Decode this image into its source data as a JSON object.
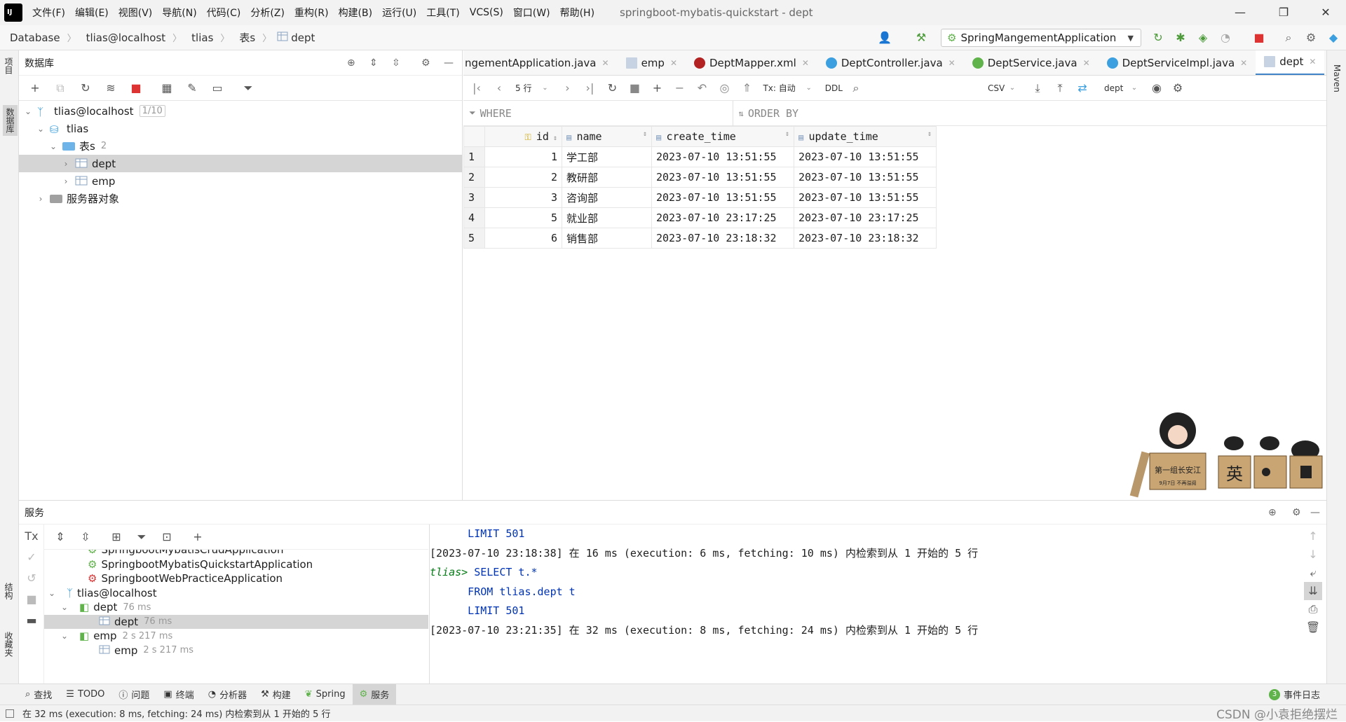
{
  "menu": [
    "文件(F)",
    "编辑(E)",
    "视图(V)",
    "导航(N)",
    "代码(C)",
    "分析(Z)",
    "重构(R)",
    "构建(B)",
    "运行(U)",
    "工具(T)",
    "VCS(S)",
    "窗口(W)",
    "帮助(H)"
  ],
  "window_title": "springboot-mybatis-quickstart - dept",
  "breadcrumb": [
    "Database",
    "tlias@localhost",
    "tlias",
    "表s",
    "dept"
  ],
  "run_config": "SpringMangementApplication",
  "left_strip": {
    "project": "项目",
    "database": "数据库",
    "structure": "结构",
    "bookmarks": "收藏夹"
  },
  "right_strip": {
    "maven": "Maven"
  },
  "db_panel": {
    "title": "数据库",
    "tree": {
      "host": "tlias@localhost",
      "host_count": "1/10",
      "schema": "tlias",
      "tables_label": "表s",
      "tables_count": "2",
      "table1": "dept",
      "table2": "emp",
      "server_objects": "服务器对象"
    }
  },
  "tabs": [
    {
      "label": "ngementApplication.java",
      "icon": "java-class-icon",
      "color": "#4083c9"
    },
    {
      "label": "emp",
      "icon": "table-icon",
      "color": "#8aa3c2"
    },
    {
      "label": "DeptMapper.xml",
      "icon": "mybatis-icon",
      "color": "#b22222"
    },
    {
      "label": "DeptController.java",
      "icon": "class-icon",
      "color": "#3ca0e0"
    },
    {
      "label": "DeptService.java",
      "icon": "interface-icon",
      "color": "#5fb34a"
    },
    {
      "label": "DeptServiceImpl.java",
      "icon": "class-icon",
      "color": "#3ca0e0"
    },
    {
      "label": "dept",
      "icon": "table-icon",
      "color": "#8aa3c2"
    }
  ],
  "grid_toolbar": {
    "rows": "5 行",
    "tx": "Tx: 自动",
    "ddl": "DDL",
    "export": "CSV",
    "schema": "dept"
  },
  "filter": {
    "where": "WHERE",
    "order_by": "ORDER BY"
  },
  "table": {
    "columns": [
      "id",
      "name",
      "create_time",
      "update_time"
    ],
    "rows": [
      {
        "n": "1",
        "id": "1",
        "name": "学工部",
        "create_time": "2023-07-10 13:51:55",
        "update_time": "2023-07-10 13:51:55"
      },
      {
        "n": "2",
        "id": "2",
        "name": "教研部",
        "create_time": "2023-07-10 13:51:55",
        "update_time": "2023-07-10 13:51:55"
      },
      {
        "n": "3",
        "id": "3",
        "name": "咨询部",
        "create_time": "2023-07-10 13:51:55",
        "update_time": "2023-07-10 13:51:55"
      },
      {
        "n": "4",
        "id": "5",
        "name": "就业部",
        "create_time": "2023-07-10 23:17:25",
        "update_time": "2023-07-10 23:17:25"
      },
      {
        "n": "5",
        "id": "6",
        "name": "销售部",
        "create_time": "2023-07-10 23:18:32",
        "update_time": "2023-07-10 23:18:32"
      }
    ]
  },
  "mascot": {
    "box1": "第一组长安江",
    "box1_sub": "9月7日 不再溢阅",
    "box2": "英"
  },
  "services": {
    "title": "服务",
    "tree": [
      {
        "label": "SpringbootMybatisCrudApplication",
        "meta": ""
      },
      {
        "label": "SpringbootMybatisQuickstartApplication",
        "meta": ""
      },
      {
        "label": "SpringbootWebPracticeApplication",
        "meta": ""
      },
      {
        "label": "tlias@localhost",
        "meta": ""
      },
      {
        "label": "dept",
        "meta": "76 ms"
      },
      {
        "label": "dept",
        "meta": "76 ms"
      },
      {
        "label": "emp",
        "meta": "2 s 217 ms"
      },
      {
        "label": "emp",
        "meta": "2 s 217 ms"
      }
    ],
    "console": {
      "l1": "      LIMIT 501",
      "l2": "[2023-07-10 23:18:38] 在 16 ms (execution: 6 ms, fetching: 10 ms) 内检索到从 1 开始的 5 行",
      "prompt": "tlias>",
      "l3": " SELECT t.*",
      "l4": "      FROM tlias.dept t",
      "l5": "      LIMIT 501",
      "l6": "[2023-07-10 23:21:35] 在 32 ms (execution: 8 ms, fetching: 24 ms) 内检索到从 1 开始的 5 行"
    }
  },
  "bottom_tabs": [
    "查找",
    "TODO",
    "问题",
    "终端",
    "分析器",
    "构建",
    "Spring",
    "服务"
  ],
  "event_log": {
    "count": "3",
    "label": "事件日志"
  },
  "status_text": "在 32 ms (execution: 8 ms, fetching: 24 ms) 内检索到从 1 开始的 5 行",
  "watermark": "CSDN @小袁拒绝摆烂"
}
